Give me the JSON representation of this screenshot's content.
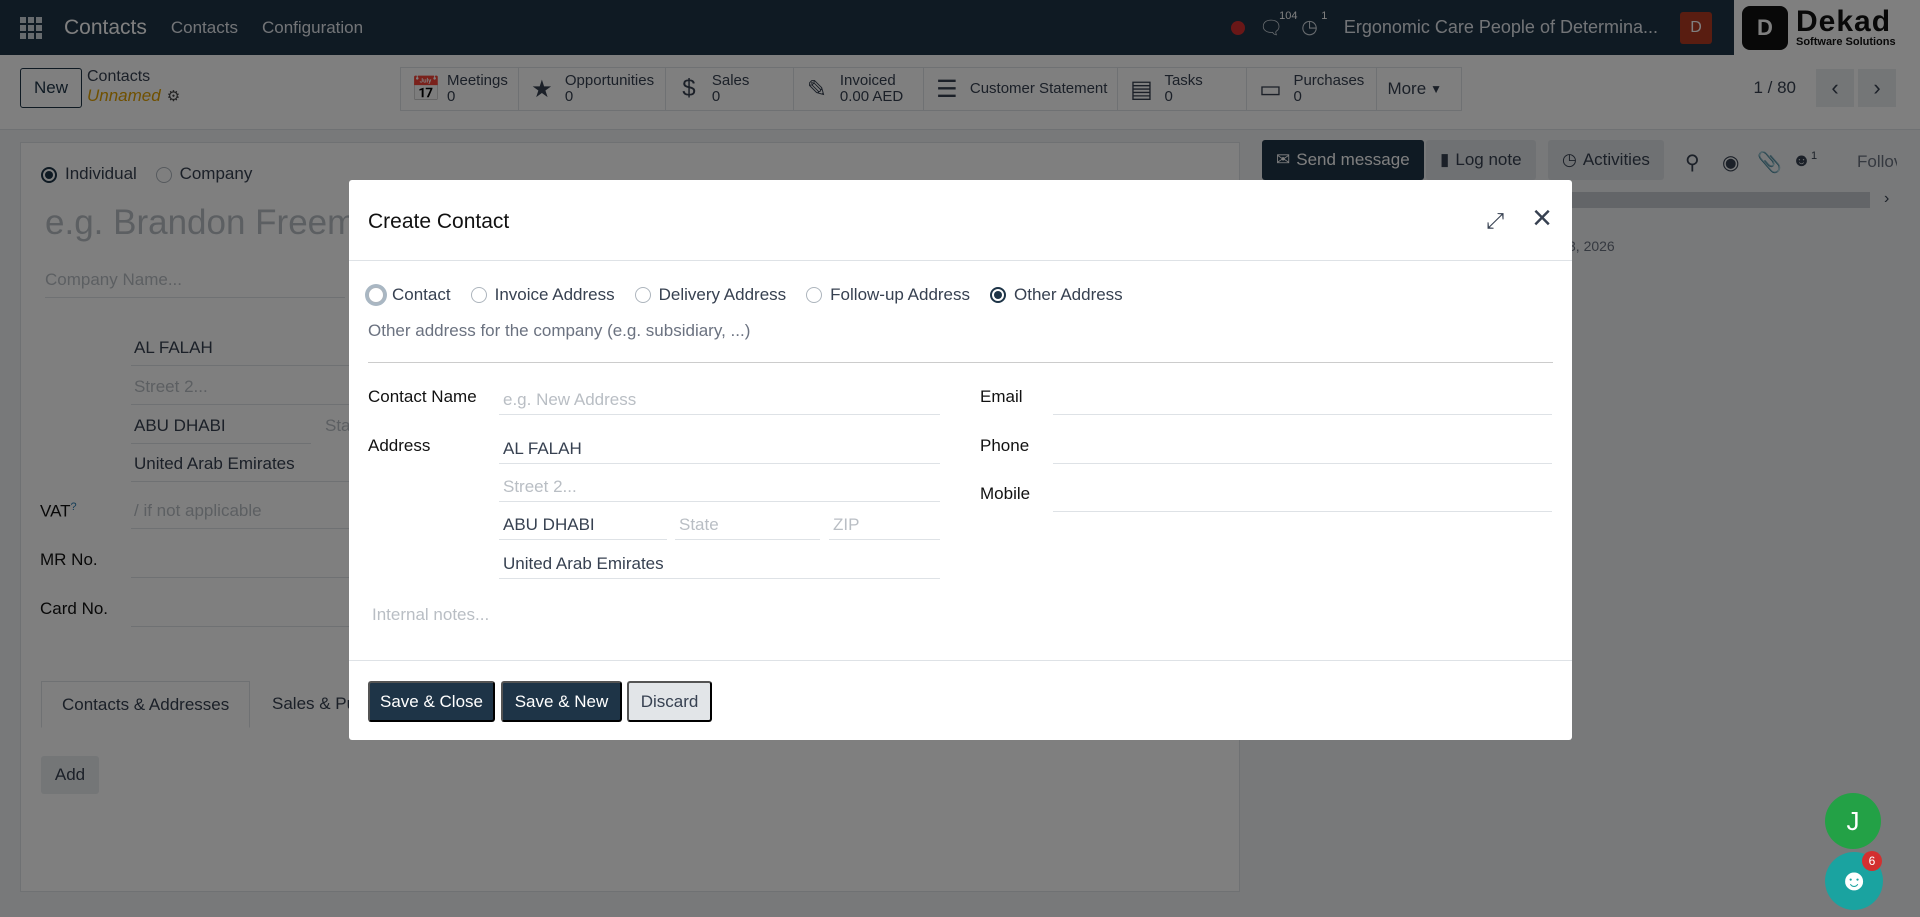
{
  "topbar": {
    "app_title": "Contacts",
    "menu": [
      "Contacts",
      "Configuration"
    ],
    "messages_count": "104",
    "activities_count": "1",
    "company": "Ergonomic Care People of Determina...",
    "user_initial": "D",
    "brand_name": "Dekad",
    "brand_sub": "Software Solutions"
  },
  "control": {
    "new_label": "New",
    "breadcrumb_parent": "Contacts",
    "breadcrumb_current": "Unnamed",
    "smart_buttons": [
      {
        "label": "Meetings",
        "value": "0",
        "icon": "calendar-icon"
      },
      {
        "label": "Opportunities",
        "value": "0",
        "icon": "star-icon"
      },
      {
        "label": "Sales",
        "value": "0",
        "icon": "dollar-icon"
      },
      {
        "label": "Invoiced",
        "value": "0.00 AED",
        "icon": "invoice-icon"
      },
      {
        "label": "Customer Statement",
        "value": "",
        "icon": "list-icon"
      },
      {
        "label": "Tasks",
        "value": "0",
        "icon": "tasks-icon"
      },
      {
        "label": "Purchases",
        "value": "0",
        "icon": "credit-card-icon"
      },
      {
        "label": "More",
        "value": "",
        "icon": "caret-down-icon"
      }
    ],
    "pager": "1 / 80"
  },
  "background_form": {
    "type_individual": "Individual",
    "type_company": "Company",
    "name_placeholder": "e.g. Brandon Freem",
    "company_placeholder": "Company Name...",
    "street": "AL FALAH",
    "street2_placeholder": "Street 2...",
    "city": "ABU DHABI",
    "state_placeholder": "Sta",
    "country": "United Arab Emirates",
    "vat_label": "VAT",
    "vat_placeholder": "/ if not applicable",
    "mr_label": "MR No.",
    "card_label": "Card No.",
    "tab_contacts": "Contacts & Addresses",
    "tab_sales": "Sales & Pu",
    "add_label": "Add"
  },
  "chatter": {
    "send_message": "Send message",
    "log_note": "Log note",
    "activities": "Activities",
    "followers_count": "1",
    "follow": "Follov",
    "date_fragment": "3, 2026"
  },
  "modal": {
    "title": "Create Contact",
    "types": [
      {
        "label": "Contact",
        "selected": false
      },
      {
        "label": "Invoice Address",
        "selected": false
      },
      {
        "label": "Delivery Address",
        "selected": false
      },
      {
        "label": "Follow-up Address",
        "selected": false
      },
      {
        "label": "Other Address",
        "selected": true
      }
    ],
    "type_description": "Other address for the company (e.g. subsidiary, ...)",
    "contact_name_label": "Contact Name",
    "contact_name_placeholder": "e.g. New Address",
    "address_label": "Address",
    "street": "AL FALAH",
    "street2_placeholder": "Street 2...",
    "city": "ABU DHABI",
    "state_placeholder": "State",
    "zip_placeholder": "ZIP",
    "country": "United Arab Emirates",
    "email_label": "Email",
    "phone_label": "Phone",
    "mobile_label": "Mobile",
    "notes_placeholder": "Internal notes...",
    "save_close": "Save & Close",
    "save_new": "Save & New",
    "discard": "Discard"
  },
  "floating": {
    "user_bubble": "J",
    "group_badge": "6"
  },
  "colors": {
    "navbar": "#1e3447",
    "primary_button": "#1e3447",
    "breadcrumb_current": "#e0a100",
    "badge_red": "#d32f2f",
    "user_bubble": "#23a146"
  }
}
